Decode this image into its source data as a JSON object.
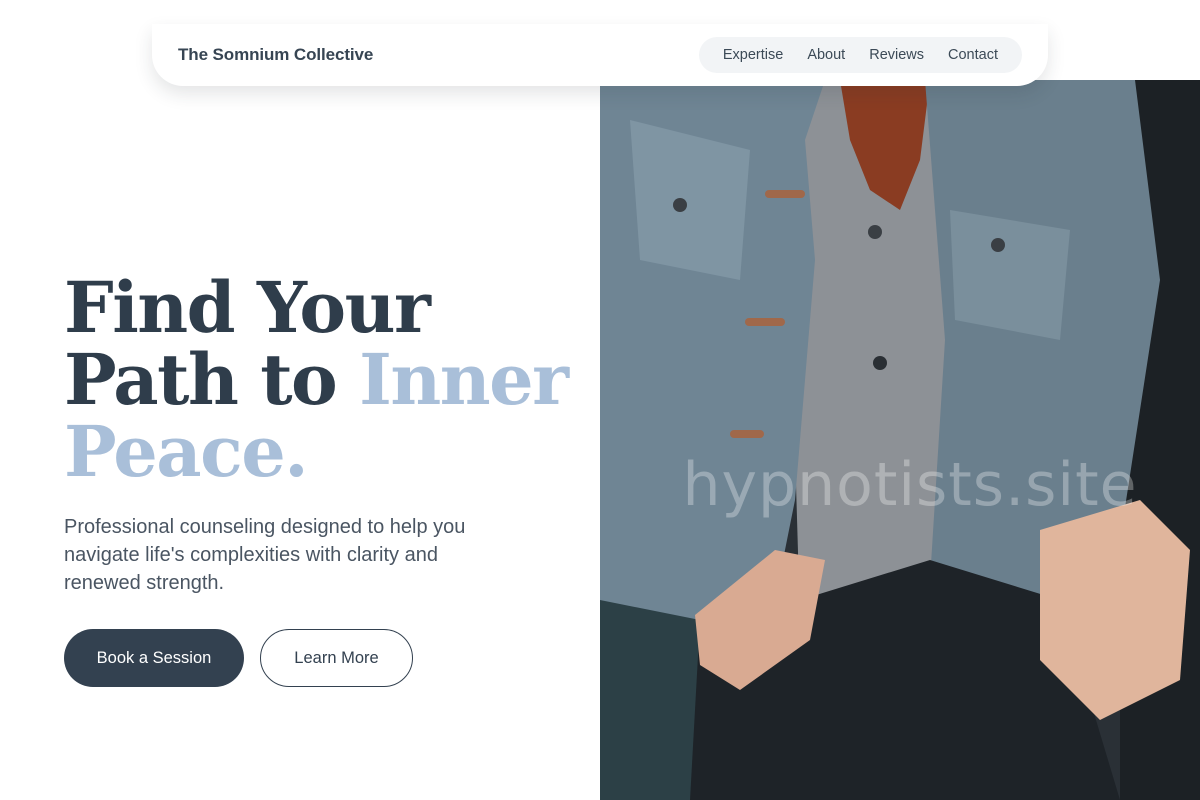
{
  "nav": {
    "brand": "The Somnium Collective",
    "links": [
      "Expertise",
      "About",
      "Reviews",
      "Contact"
    ]
  },
  "hero": {
    "title_line1": "Find Your",
    "title_line2_plain": "Path to ",
    "title_line2_accent": "Inner",
    "title_line3_accent": "Peace.",
    "subtitle": "Professional counseling designed to help you navigate life's complexities with clarity and renewed strength.",
    "primary_button": "Book a Session",
    "secondary_button": "Learn More",
    "watermark": "hypnotists.site"
  },
  "colors": {
    "primary": "#334150",
    "accent": "#a9bfd9",
    "background": "#ffffff"
  }
}
